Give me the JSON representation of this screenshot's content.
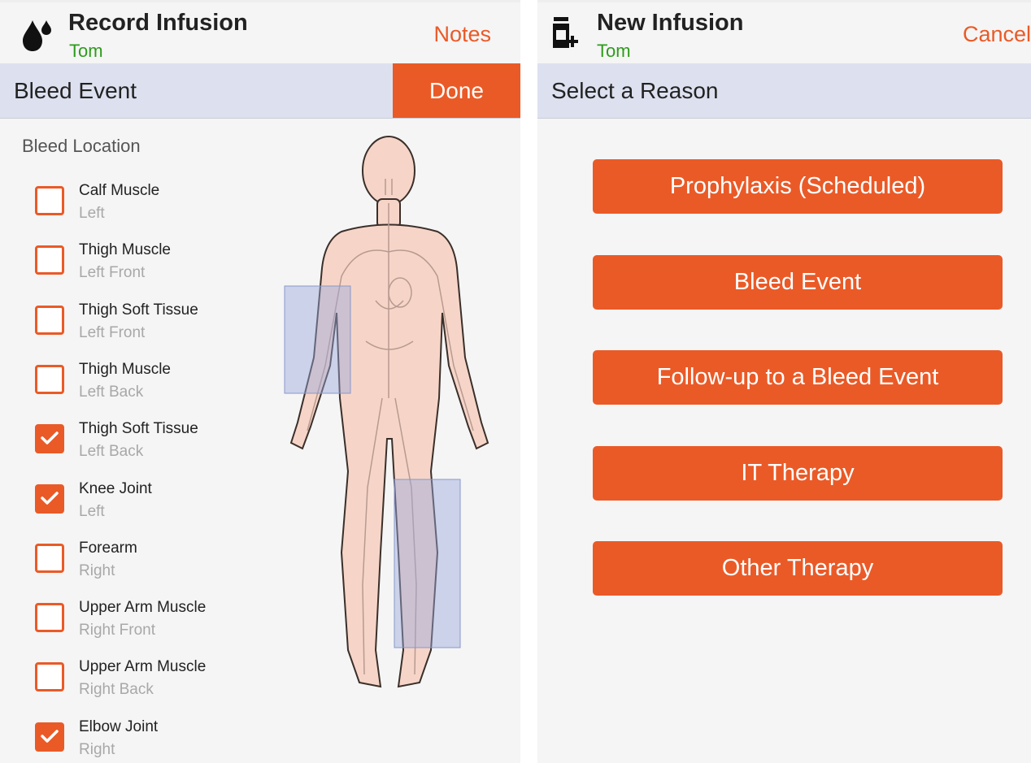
{
  "left": {
    "title": "Record Infusion",
    "patient": "Tom",
    "notes_label": "Notes",
    "section_title": "Bleed Event",
    "done_label": "Done",
    "location_heading": "Bleed Location",
    "locations": [
      {
        "name": "Calf Muscle",
        "side": "Left",
        "checked": false
      },
      {
        "name": "Thigh Muscle",
        "side": "Left Front",
        "checked": false
      },
      {
        "name": "Thigh Soft Tissue",
        "side": "Left Front",
        "checked": false
      },
      {
        "name": "Thigh Muscle",
        "side": "Left Back",
        "checked": false
      },
      {
        "name": "Thigh Soft Tissue",
        "side": "Left Back",
        "checked": true
      },
      {
        "name": "Knee Joint",
        "side": "Left",
        "checked": true
      },
      {
        "name": "Forearm",
        "side": "Right",
        "checked": false
      },
      {
        "name": "Upper Arm Muscle",
        "side": "Right Front",
        "checked": false
      },
      {
        "name": "Upper Arm Muscle",
        "side": "Right Back",
        "checked": false
      },
      {
        "name": "Elbow Joint",
        "side": "Right",
        "checked": true
      }
    ],
    "icon": "blood-drop-icon"
  },
  "right": {
    "title": "New Infusion",
    "patient": "Tom",
    "cancel_label": "Cancel",
    "section_title": "Select a Reason",
    "reasons": [
      "Prophylaxis (Scheduled)",
      "Bleed Event",
      "Follow-up to a Bleed Event",
      "IT Therapy",
      "Other Therapy"
    ],
    "icon": "medicine-vial-add-icon"
  },
  "colors": {
    "accent": "#ea5a27",
    "patient_name": "#2e9b1a",
    "header_band": "#dde1ef",
    "highlight": "#9aa8dc"
  }
}
